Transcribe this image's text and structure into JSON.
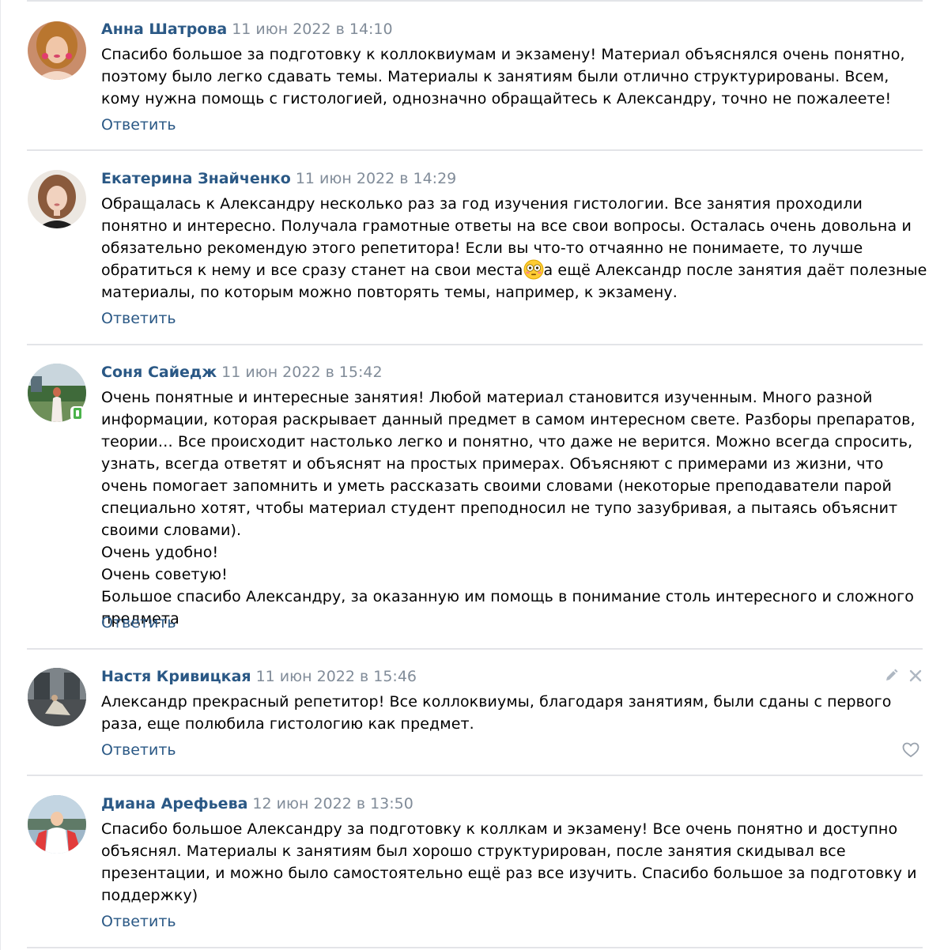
{
  "colors": {
    "author": "#2a5885",
    "date": "#818c99",
    "link": "#2a5885",
    "divider": "#e3e4e8",
    "icon": "#aeb7c2"
  },
  "comments": [
    {
      "author": "Анна Шатрова",
      "date": "11 июн 2022 в 14:10",
      "text": "Спасибо большое за подготовку к коллоквиумам и экзамену! Материал объяснялся очень понятно, поэтому было легко сдавать темы. Материалы к занятиям были отлично структурированы. Всем, кому нужна помощь с гистологией, однозначно обращайтесь к Александру, точно не пожалеете!",
      "reply_label": "Ответить"
    },
    {
      "author": "Екатерина Знайченко",
      "date": "11 июн 2022 в 14:29",
      "text_before_emoji": "Обращалась к Александру несколько раз за год изучения гистологии. Все занятия проходили понятно и интересно. Получала грамотные ответы на все свои вопросы. Осталась очень довольна и обязательно рекомендую этого репетитора! Если вы что-то отчаянно не понимаете, то лучше обратиться к нему и все сразу станет на свои места",
      "emoji": "flushed-face-emoji",
      "text_after_emoji": "а ещё Александр после занятия даёт полезные материалы, по которым можно повторять темы, например, к экзамену.",
      "reply_label": "Ответить"
    },
    {
      "author": "Соня Сайедж",
      "date": "11 июн 2022 в 15:42",
      "online_badge": "mobile-online-icon",
      "text": "Очень понятные и интересные занятия! Любой материал становится изученным. Много разной информации, которая раскрывает данный предмет в самом интересном свете. Разборы препаратов, теории… Все происходит настолько легко и понятно, что даже не верится. Можно всегда спросить, узнать, всегда ответят и объяснят на простых примерах. Объясняют с примерами из жизни, что очень помогает запомнить и уметь рассказать своими словами (некоторые преподаватели парой специально хотят, чтобы материал студент преподносил не тупо зазубривая, а пытаясь объяснит своими словами).\nОчень удобно!\nОчень советую!\nБольшое спасибо Александру, за оказанную им помощь в понимание столь интересного и сложного предмета",
      "reply_label": "Ответить"
    },
    {
      "author": "Настя Кривицкая",
      "date": "11 июн 2022 в 15:46",
      "text": "Александр прекрасный репетитор! Все коллоквиумы, благодаря занятиям, были сданы с первого раза, еще полюбила гистологию как предмет.",
      "reply_label": "Ответить",
      "actions": [
        "edit-icon",
        "close-icon",
        "like-heart-icon"
      ]
    },
    {
      "author": "Диана Арефьева",
      "date": "12 июн 2022 в 13:50",
      "text": "Спасибо большое Александру за подготовку к коллкам и экзамену! Все очень понятно и доступно объяснял. Материалы к занятиям был хорошо структурирован, после занятия скидывал все презентации, и можно было самостоятельно ещё раз все изучить. Спасибо большое за подготовку и поддержку)",
      "reply_label": "Ответить"
    }
  ]
}
